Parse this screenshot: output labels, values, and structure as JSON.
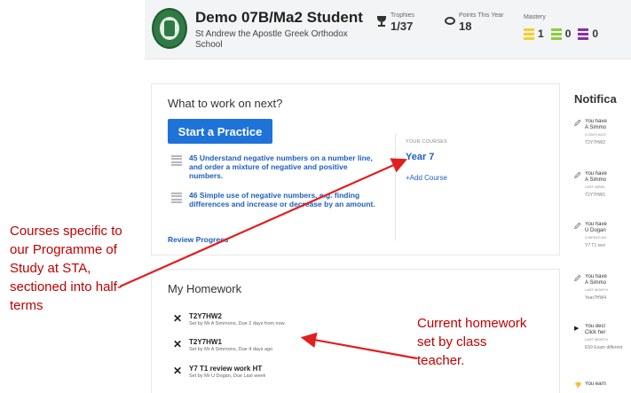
{
  "header": {
    "student_name": "Demo 07B/Ma2 Student",
    "school_name": "St Andrew the Apostle Greek Orthodox School",
    "trophies_label": "Trophies",
    "trophies_value": "1/37",
    "points_label": "Points This Year",
    "points_value": "18",
    "mastery_label": "Mastery",
    "mastery": [
      {
        "count": "1",
        "color": "#f0d22a"
      },
      {
        "count": "0",
        "color": "#8ccc3a"
      },
      {
        "count": "0",
        "color": "#8a2fa8"
      }
    ]
  },
  "next": {
    "title": "What to work on next?",
    "start_button": "Start a Practice",
    "suggestions": [
      "45  Understand negative numbers on a number line, and order a mixture of negative and positive numbers.",
      "46  Simple use of negative numbers, e.g. finding differences and increase or decrease by an amount."
    ],
    "review_link": "Review Progress",
    "courses_label": "YOUR COURSES",
    "course": "Year 7",
    "add_course": "+Add Course"
  },
  "homework": {
    "title": "My Homework",
    "items": [
      {
        "name": "T2Y7HW2",
        "meta": "Set by Mr A Simmons, Due 2 days from now"
      },
      {
        "name": "T2Y7HW1",
        "meta": "Set by Mr A Simmons, Due 4 days ago"
      },
      {
        "name": "Y7 T1 review work HT",
        "meta": "Set by Mr U Dogan, Due Last week"
      }
    ]
  },
  "notifications": {
    "title": "Notifica",
    "items": [
      {
        "icon": "pin-icon",
        "l1": "You have",
        "l2": "A Simmo",
        "time": "4 DAYS AGO",
        "sub": "T2Y7HW2"
      },
      {
        "icon": "pin-icon",
        "l1": "You have",
        "l2": "A Simmo",
        "time": "LAST WEEK",
        "sub": "T2Y7HW1"
      },
      {
        "icon": "pin-icon",
        "l1": "You have",
        "l2": "U Dogan",
        "time": "3 WEEKS AG",
        "sub": "Y7 T1 revi"
      },
      {
        "icon": "pin-icon",
        "l1": "You have",
        "l2": "A Simmo",
        "time": "LAST MONTH",
        "sub": "Year7HW4"
      },
      {
        "icon": "play-icon",
        "l1": "You decl",
        "l2": "Click her",
        "time": "LAST MONTH",
        "sub": "E59 Exam different"
      },
      {
        "icon": "trophy-icon",
        "l1": "You earn",
        "l2": "",
        "time": "",
        "sub": ""
      }
    ]
  },
  "annotations": {
    "left": "Courses specific to our Programme of Study at STA, sectioned into half-terms",
    "right": "Current homework set by class teacher.",
    "color": "#c00000"
  }
}
